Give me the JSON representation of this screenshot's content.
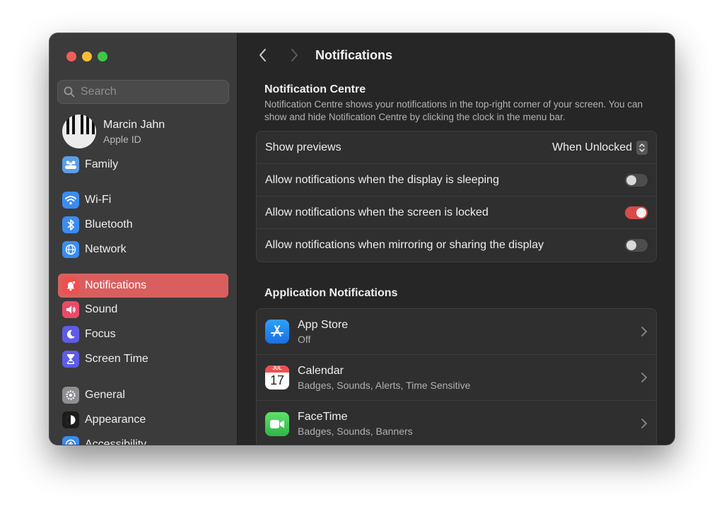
{
  "sidebar": {
    "search_placeholder": "Search",
    "profile": {
      "name": "Marcin Jahn",
      "subtitle": "Apple ID"
    },
    "items": [
      {
        "label": "Family",
        "icon": "family-icon",
        "color": "#5b9de8"
      },
      {
        "label": "Wi-Fi",
        "icon": "wifi-icon",
        "color": "#3b8cf0"
      },
      {
        "label": "Bluetooth",
        "icon": "bluetooth-icon",
        "color": "#3b8cf0"
      },
      {
        "label": "Network",
        "icon": "globe-icon",
        "color": "#3b8cf0"
      },
      {
        "label": "Notifications",
        "icon": "bell-icon",
        "color": "#ee4f4f",
        "active": true
      },
      {
        "label": "Sound",
        "icon": "speaker-icon",
        "color": "#eb4a68"
      },
      {
        "label": "Focus",
        "icon": "moon-icon",
        "color": "#5e5ce6"
      },
      {
        "label": "Screen Time",
        "icon": "hourglass-icon",
        "color": "#5e5ce6"
      },
      {
        "label": "General",
        "icon": "gear-icon",
        "color": "#8e8e93"
      },
      {
        "label": "Appearance",
        "icon": "appearance-icon",
        "color": "#1c1c1c"
      },
      {
        "label": "Accessibility",
        "icon": "accessibility-icon",
        "color": "#3b8cf0"
      }
    ]
  },
  "main": {
    "title": "Notifications",
    "notification_centre": {
      "heading": "Notification Centre",
      "description": "Notification Centre shows your notifications in the top-right corner of your screen. You can show and hide Notification Centre by clicking the clock in the menu bar.",
      "show_previews_label": "Show previews",
      "show_previews_value": "When Unlocked",
      "toggles": [
        {
          "label": "Allow notifications when the display is sleeping",
          "on": false
        },
        {
          "label": "Allow notifications when the screen is locked",
          "on": true
        },
        {
          "label": "Allow notifications when mirroring or sharing the display",
          "on": false
        }
      ]
    },
    "app_notifications": {
      "heading": "Application Notifications",
      "apps": [
        {
          "name": "App Store",
          "detail": "Off",
          "icon": "app-store-icon"
        },
        {
          "name": "Calendar",
          "detail": "Badges, Sounds, Alerts, Time Sensitive",
          "icon": "calendar-icon",
          "cal_month": "JUL",
          "cal_day": "17"
        },
        {
          "name": "FaceTime",
          "detail": "Badges, Sounds, Banners",
          "icon": "facetime-icon"
        }
      ]
    }
  },
  "colors": {
    "accent": "#d95f5f",
    "toggle_on": "#d94a4a"
  }
}
